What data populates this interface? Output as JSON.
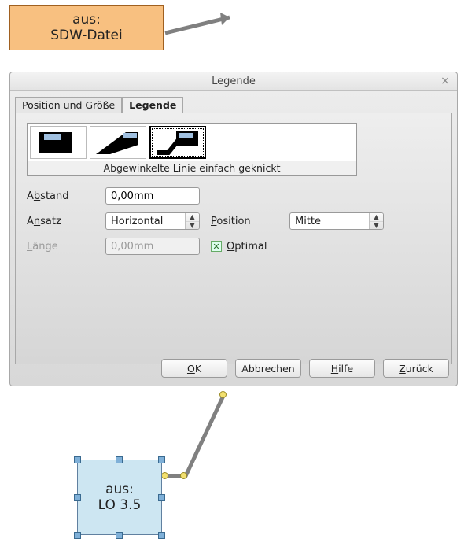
{
  "callout_top": {
    "line1": "aus:",
    "line2": "SDW-Datei"
  },
  "dialog": {
    "title": "Legende",
    "tabs": {
      "pos": "Position und Größe",
      "leg": "Legende"
    },
    "style_caption": "Abgewinkelte Linie einfach geknickt",
    "labels": {
      "abstand": "Abstand",
      "abstand_u": "b",
      "ansatz": "Ansatz",
      "ansatz_u": "n",
      "laenge": "Länge",
      "laenge_u": "L",
      "position": "Position",
      "position_u": "P",
      "optimal": "Optimal",
      "optimal_u": "O"
    },
    "values": {
      "abstand": "0,00mm",
      "ansatz": "Horizontal",
      "laenge": "0,00mm",
      "position": "Mitte",
      "optimal_checked": true
    },
    "buttons": {
      "ok": "OK",
      "ok_u": "O",
      "cancel": "Abbrechen",
      "help": "Hilfe",
      "help_u": "H",
      "reset": "Zurück",
      "reset_u": "Z"
    }
  },
  "callout_bottom": {
    "line1": "aus:",
    "line2": "LO 3.5"
  }
}
